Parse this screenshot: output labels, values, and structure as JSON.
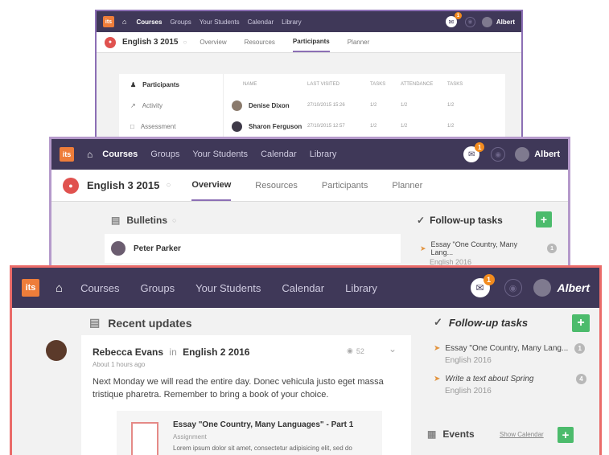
{
  "colors": {
    "nav": "#3f3858",
    "accent_orange": "#ee7d3a",
    "green": "#4cbb6c",
    "course_red": "#e0524f",
    "border_top": "#8c6fb5",
    "border_mid": "#b59acb",
    "border_front": "#ea6b69"
  },
  "icons": {
    "home": "home-icon",
    "mail": "mail-icon",
    "bell": "bell-icon",
    "check": "check-icon",
    "plus": "plus-icon",
    "pin": "pin-icon",
    "calendar": "calendar-icon",
    "newspaper": "newspaper-icon"
  },
  "nav": {
    "logo": "its",
    "items": [
      "Courses",
      "Groups",
      "Your Students",
      "Calendar",
      "Library"
    ],
    "mail_badge": "1",
    "user": "Albert"
  },
  "window_top": {
    "course": "English 3 2015",
    "tabs": [
      "Overview",
      "Resources",
      "Participants",
      "Planner"
    ],
    "side_menu": [
      "Participants",
      "Activity",
      "Assessment"
    ],
    "table_headers": [
      "NAME",
      "LAST VISITED",
      "TASKS",
      "ATTENDANCE",
      "TASKS"
    ],
    "rows": [
      {
        "name": "Denise Dixon",
        "last": "27/10/2015 15:26",
        "tasks": "1/2",
        "attendance": "1/2",
        "tasks2": "1/2"
      },
      {
        "name": "Sharon Ferguson",
        "last": "27/10/2015 12:57",
        "tasks": "1/2",
        "attendance": "1/2",
        "tasks2": "1/2"
      }
    ]
  },
  "window_mid": {
    "course": "English 3 2015",
    "tabs": [
      "Overview",
      "Resources",
      "Participants",
      "Planner"
    ],
    "bulletins_title": "Bulletins",
    "bulletin_author": "Peter Parker",
    "followup_title": "Follow-up tasks",
    "task": {
      "title": "Essay \"One Country, Many Lang...",
      "course": "English 2016",
      "count": "1"
    }
  },
  "window_front": {
    "recent_title": "Recent updates",
    "post": {
      "author": "Rebecca Evans",
      "in": "in",
      "course": "English 2 2016",
      "time": "About 1 hours ago",
      "views": "52",
      "body": "Next Monday we will read the entire day. Donec vehicula justo eget massa tristique pharetra. Remember to bring a book of your choice.",
      "attachment_title": "Essay \"One Country, Many Languages\" - Part 1",
      "attachment_type": "Assignment",
      "attachment_excerpt": "Lorem ipsum dolor sit amet, consectetur adipisicing elit, sed do"
    },
    "followup_title": "Follow-up tasks",
    "tasks": [
      {
        "title": "Essay \"One Country, Many Lang...",
        "course": "English 2016",
        "count": "1"
      },
      {
        "title": "Write a text about Spring",
        "course": "English 2016",
        "count": "4"
      }
    ],
    "events_title": "Events",
    "show_calendar": "Show Calendar"
  }
}
